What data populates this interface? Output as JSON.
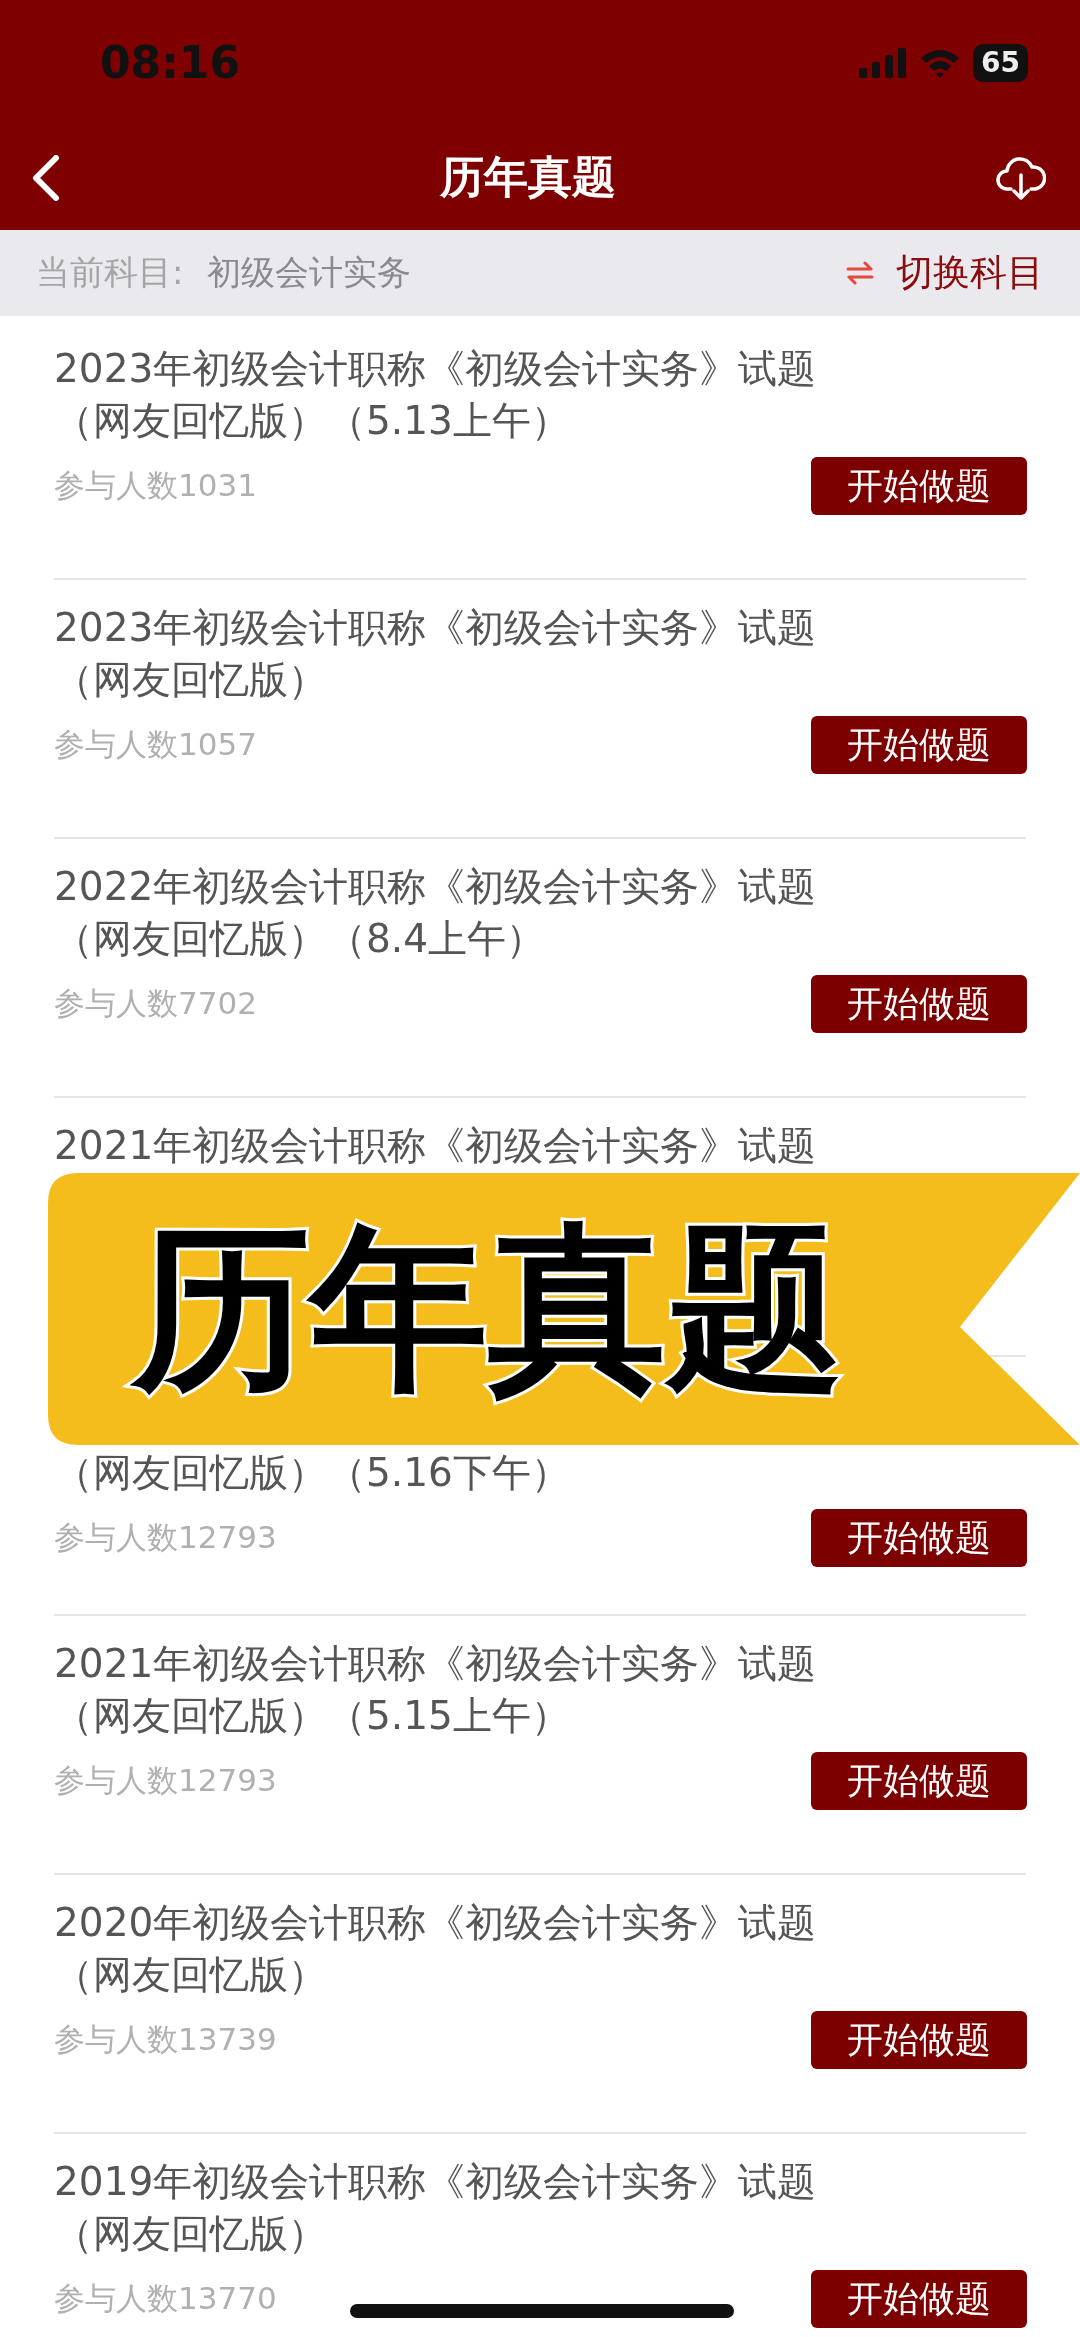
{
  "status_bar": {
    "time": "08:16",
    "battery": "65"
  },
  "nav": {
    "title": "历年真题"
  },
  "subject_bar": {
    "label": "当前科目:",
    "subject": "初级会计实务",
    "switch": "切换科目"
  },
  "items": [
    {
      "kind": "full",
      "title_lines": [
        "2023年初级会计职称《初级会计实务》试题",
        "（网友回忆版）（5.13上午）"
      ],
      "count": "参与人数1031",
      "button": "开始做题"
    },
    {
      "kind": "full",
      "title_lines": [
        "2023年初级会计职称《初级会计实务》试题",
        "（网友回忆版）"
      ],
      "count": "参与人数1057",
      "button": "开始做题"
    },
    {
      "kind": "full",
      "title_lines": [
        "2022年初级会计职称《初级会计实务》试题",
        "（网友回忆版）（8.4上午）"
      ],
      "count": "参与人数7702",
      "button": "开始做题"
    },
    {
      "kind": "head",
      "title_lines": [
        "2021年初级会计职称《初级会计实务》试题"
      ]
    },
    {
      "kind": "tail",
      "title_lines": [
        "（网友回忆版）（5.16下午）"
      ],
      "count": "参与人数12793",
      "button": "开始做题"
    },
    {
      "kind": "full",
      "title_lines": [
        "2021年初级会计职称《初级会计实务》试题",
        "（网友回忆版）（5.15上午）"
      ],
      "count": "参与人数12793",
      "button": "开始做题"
    },
    {
      "kind": "full",
      "title_lines": [
        "2020年初级会计职称《初级会计实务》试题",
        "（网友回忆版）"
      ],
      "count": "参与人数13739",
      "button": "开始做题"
    },
    {
      "kind": "full",
      "title_lines": [
        "2019年初级会计职称《初级会计实务》试题",
        "（网友回忆版）"
      ],
      "count": "参与人数13770",
      "button": "开始做题"
    }
  ],
  "overlay_banner": {
    "text": "历年真题"
  }
}
